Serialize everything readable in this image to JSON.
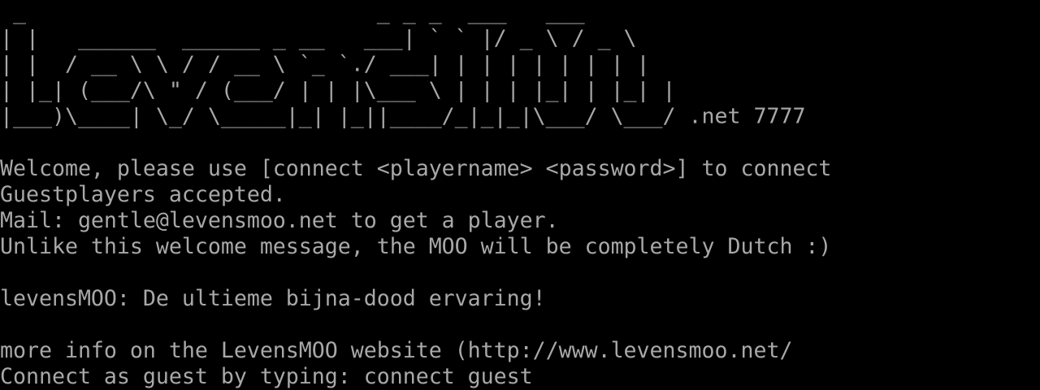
{
  "terminal": {
    "banner": [
      " _                           _ _ _  ___   ___",
      "| |   ______  ______ _ __   ___| ` ` |/ _ \\ / _ \\",
      "| |  / __ \\ \\ / / __ \\ `_ `./ ___| | | | | | | | |",
      "| |_| (___/\\ \" / (___/ | | |\\___ \\ | | | |_| | |_| |",
      "|___)\\____| \\_/ \\_____|_| |_||____/_|_|_|\\___/ \\___/ .net 7777"
    ],
    "lines": [
      "",
      "Welcome, please use [connect <playername> <password>] to connect",
      "Guestplayers accepted.",
      "Mail: gentle@levensmoo.net to get a player.",
      "Unlike this welcome message, the MOO will be completely Dutch :)",
      "",
      "levensMOO: De ultieme bijna-dood ervaring!",
      "",
      "more info on the LevensMOO website (http://www.levensmoo.net/",
      "Connect as guest by typing: connect guest"
    ]
  },
  "colors": {
    "background": "#000000",
    "foreground": "#a8a8a8"
  }
}
